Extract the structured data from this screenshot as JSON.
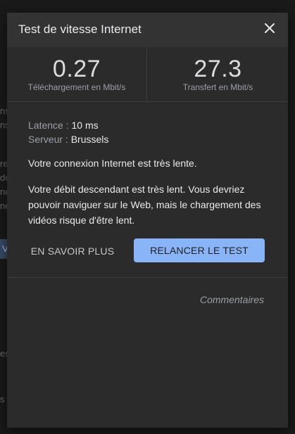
{
  "dialog": {
    "title": "Test de vitesse Internet",
    "close_icon": "close-icon"
  },
  "stats": {
    "download": {
      "value": "0.27",
      "label": "Téléchargement en Mbit/s"
    },
    "upload": {
      "value": "27.3",
      "label": "Transfert en Mbit/s"
    }
  },
  "details": {
    "latency_label": "Latence :",
    "latency_value": "10 ms",
    "server_label": "Serveur :",
    "server_value": "Brussels"
  },
  "messages": {
    "summary": "Votre connexion Internet est très lente.",
    "explanation": "Votre débit descendant est très lent. Vous devriez pouvoir naviguer sur le Web, mais le chargement des vidéos risque d'être lent."
  },
  "actions": {
    "learn_more": "EN SAVOIR PLUS",
    "rerun": "RELANCER LE TEST",
    "feedback": "Commentaires"
  },
  "colors": {
    "accent": "#8ab4f8",
    "dialog_bg": "#2b2b2b",
    "header_bg": "#333333"
  }
}
